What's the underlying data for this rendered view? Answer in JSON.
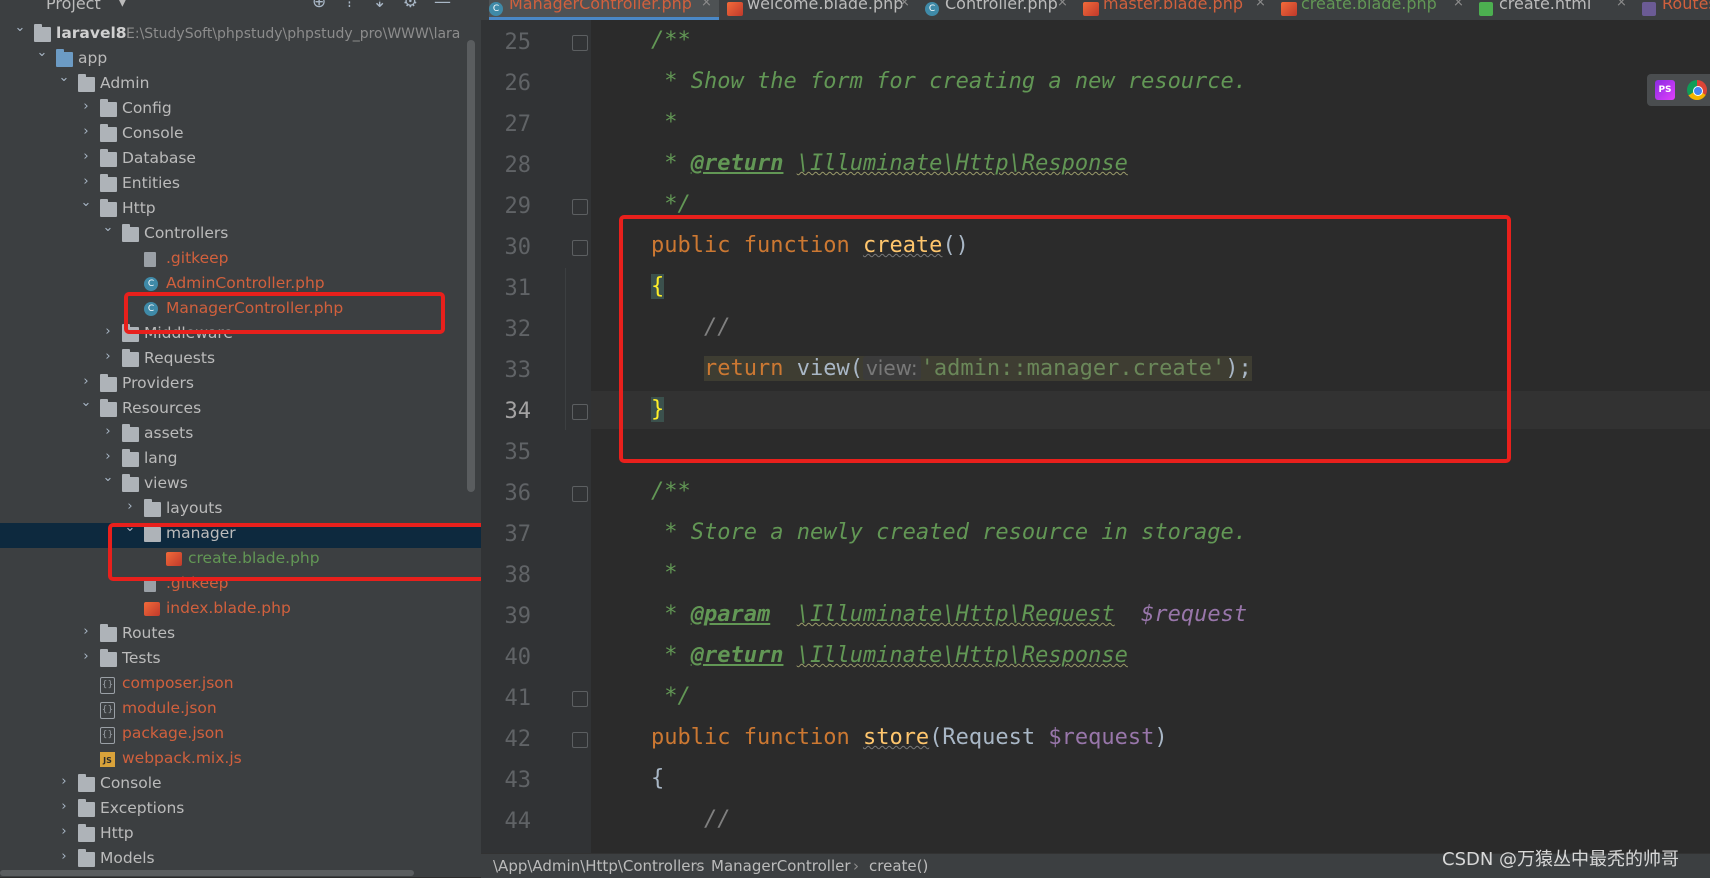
{
  "sidebar": {
    "title": "Project",
    "rows": [
      {
        "label": "laravel8",
        "path": "E:\\StudySoft\\phpstudy\\phpstudy_pro\\WWW\\lara",
        "indent": 0,
        "arrow": "down",
        "icon": "folder",
        "bold": true
      },
      {
        "label": "app",
        "indent": 1,
        "arrow": "down",
        "icon": "folder-blue"
      },
      {
        "label": "Admin",
        "indent": 2,
        "arrow": "down",
        "icon": "folder"
      },
      {
        "label": "Config",
        "indent": 3,
        "arrow": "right",
        "icon": "folder"
      },
      {
        "label": "Console",
        "indent": 3,
        "arrow": "right",
        "icon": "folder"
      },
      {
        "label": "Database",
        "indent": 3,
        "arrow": "right",
        "icon": "folder"
      },
      {
        "label": "Entities",
        "indent": 3,
        "arrow": "right",
        "icon": "folder"
      },
      {
        "label": "Http",
        "indent": 3,
        "arrow": "down",
        "icon": "folder"
      },
      {
        "label": "Controllers",
        "indent": 4,
        "arrow": "down",
        "icon": "folder"
      },
      {
        "label": ".gitkeep",
        "indent": 5,
        "icon": "file",
        "color": "red"
      },
      {
        "label": "AdminController.php",
        "indent": 5,
        "icon": "class",
        "color": "red"
      },
      {
        "label": "ManagerController.php",
        "indent": 5,
        "icon": "class",
        "color": "red"
      },
      {
        "label": "Middleware",
        "indent": 4,
        "arrow": "right",
        "icon": "folder"
      },
      {
        "label": "Requests",
        "indent": 4,
        "arrow": "right",
        "icon": "folder"
      },
      {
        "label": "Providers",
        "indent": 3,
        "arrow": "right",
        "icon": "folder"
      },
      {
        "label": "Resources",
        "indent": 3,
        "arrow": "down",
        "icon": "folder"
      },
      {
        "label": "assets",
        "indent": 4,
        "arrow": "right",
        "icon": "folder"
      },
      {
        "label": "lang",
        "indent": 4,
        "arrow": "right",
        "icon": "folder"
      },
      {
        "label": "views",
        "indent": 4,
        "arrow": "down",
        "icon": "folder"
      },
      {
        "label": "layouts",
        "indent": 5,
        "arrow": "right",
        "icon": "folder"
      },
      {
        "label": "manager",
        "indent": 5,
        "arrow": "down",
        "icon": "folder",
        "selected": true
      },
      {
        "label": "create.blade.php",
        "indent": 6,
        "icon": "blade",
        "color": "green"
      },
      {
        "label": ".gitkeep",
        "indent": 5,
        "icon": "file",
        "color": "red"
      },
      {
        "label": "index.blade.php",
        "indent": 5,
        "icon": "blade",
        "color": "red"
      },
      {
        "label": "Routes",
        "indent": 3,
        "arrow": "right",
        "icon": "folder"
      },
      {
        "label": "Tests",
        "indent": 3,
        "arrow": "right",
        "icon": "folder"
      },
      {
        "label": "composer.json",
        "indent": 3,
        "icon": "json",
        "color": "red"
      },
      {
        "label": "module.json",
        "indent": 3,
        "icon": "json",
        "color": "red"
      },
      {
        "label": "package.json",
        "indent": 3,
        "icon": "json",
        "color": "red"
      },
      {
        "label": "webpack.mix.js",
        "indent": 3,
        "icon": "js",
        "color": "red"
      },
      {
        "label": "Console",
        "indent": 2,
        "arrow": "right",
        "icon": "folder"
      },
      {
        "label": "Exceptions",
        "indent": 2,
        "arrow": "right",
        "icon": "folder"
      },
      {
        "label": "Http",
        "indent": 2,
        "arrow": "right",
        "icon": "folder"
      },
      {
        "label": "Models",
        "indent": 2,
        "arrow": "right",
        "icon": "folder"
      }
    ]
  },
  "tabs": [
    {
      "label": "ManagerController.php",
      "icon": "class",
      "color": "red",
      "active": true
    },
    {
      "label": "welcome.blade.php",
      "icon": "blade",
      "color": "default"
    },
    {
      "label": "Controller.php",
      "icon": "class",
      "color": "default"
    },
    {
      "label": "master.blade.php",
      "icon": "blade",
      "color": "red"
    },
    {
      "label": "create.blade.php",
      "icon": "blade",
      "color": "green"
    },
    {
      "label": "create.html",
      "icon": "html",
      "color": "default"
    },
    {
      "label": "Routes",
      "icon": "php",
      "color": "red"
    }
  ],
  "editor": {
    "line_numbers": [
      "25",
      "26",
      "27",
      "28",
      "29",
      "30",
      "31",
      "32",
      "33",
      "34",
      "35",
      "36",
      "37",
      "38",
      "39",
      "40",
      "41",
      "42",
      "43",
      "44"
    ],
    "current_line": "34",
    "doc1": {
      "open": "/**",
      "desc": "* Show the form for creating a new resource.",
      "star": "*",
      "ret_tag": "@return",
      "ret_type": "\\Illuminate\\Http\\Response",
      "close": "*/"
    },
    "create_fn": {
      "kw_public": "public",
      "kw_function": "function",
      "name": "create",
      "parens": "()",
      "open_brace": "{",
      "comment": "//",
      "kw_return": "return",
      "call": "view(",
      "hint": "view:",
      "arg": "'admin::manager.create'",
      "end": ");",
      "close_brace": "}"
    },
    "doc2": {
      "open": "/**",
      "desc": "* Store a newly created resource in storage.",
      "star": "*",
      "param_tag": "@param",
      "param_type": "\\Illuminate\\Http\\Request",
      "param_var": "$request",
      "ret_tag": "@return",
      "ret_type": "\\Illuminate\\Http\\Response",
      "close": "*/"
    },
    "store_fn": {
      "kw_public": "public",
      "kw_function": "function",
      "name": "store",
      "open": "(Request ",
      "var": "$request",
      "close": ")",
      "open_brace": "{",
      "comment": "//"
    }
  },
  "breadcrumb": [
    "\\App\\Admin\\Http\\Controllers",
    "ManagerController",
    "create()"
  ],
  "breadcrumb_sep": "›",
  "watermark": "CSDN @万猿丛中最秃的帅哥",
  "icons": {
    "ide": "PS",
    "close": "×",
    "tab_close": "×",
    "arrow_down": "⌄",
    "arrow_right": "›"
  },
  "colors": {
    "highlight_box": "#e8201c",
    "tab_accent": "#4a88c7",
    "selected_row": "#0d293e"
  }
}
